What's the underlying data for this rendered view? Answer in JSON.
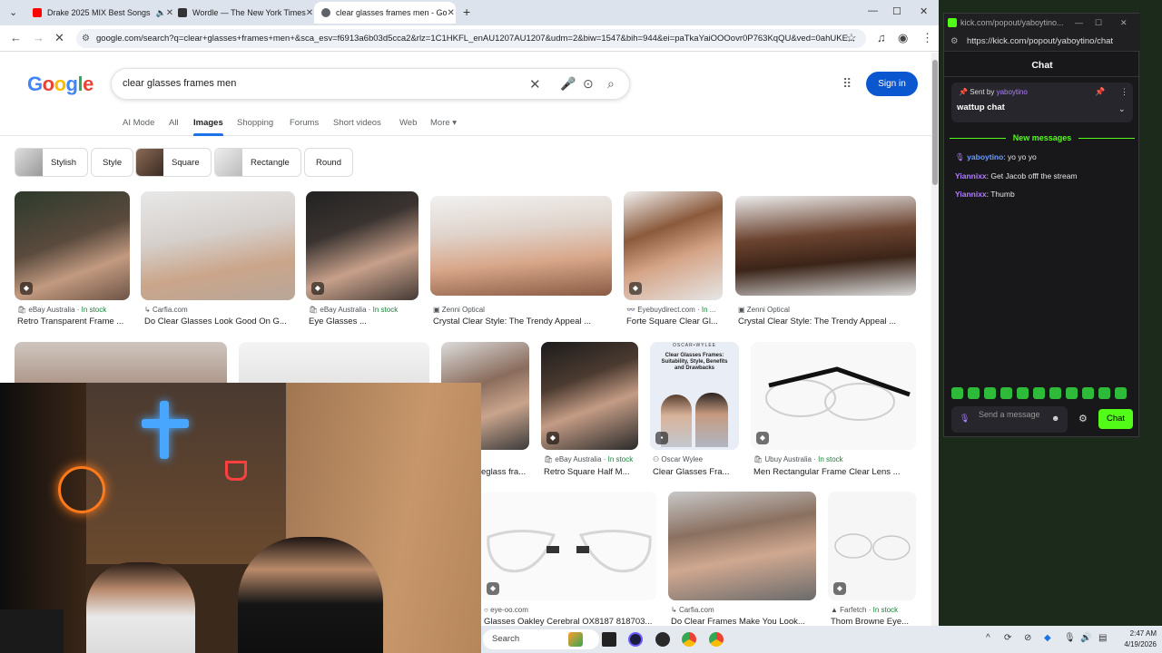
{
  "browser": {
    "tabs": [
      {
        "label": "Drake 2025 MIX Best Songs",
        "favicon_color": "#ff0000"
      },
      {
        "label": "Wordle — The New York Times",
        "favicon_color": "#333333"
      },
      {
        "label": "clear glasses frames men - Go",
        "favicon_color": "#5f6368"
      }
    ],
    "url": "google.com/search?q=clear+glasses+frames+men+&sca_esv=f6913a6b03d5cca2&rlz=1C1HKFL_enAU1207AU1207&udm=2&biw=1547&bih=944&ei=paTkaYaiOOOovr0P763KqQU&ved=0ahUKE..."
  },
  "google": {
    "logo": "Google",
    "query": "clear glasses frames men",
    "sign_in": "Sign in",
    "tabs": [
      "AI Mode",
      "All",
      "Images",
      "Shopping",
      "Forums",
      "Short videos",
      "Web",
      "More"
    ],
    "active_tab": "Images",
    "chips": [
      "Stylish",
      "Style",
      "Square",
      "Rectangle",
      "Round"
    ],
    "results": [
      {
        "source": "eBay Australia",
        "stock": "In stock",
        "title": "Retro Transparent Frame ..."
      },
      {
        "source": "Carfia.com",
        "stock": "",
        "title": "Do Clear Glasses Look Good On G..."
      },
      {
        "source": "eBay Australia",
        "stock": "In stock",
        "title": "Eye Glasses ..."
      },
      {
        "source": "Zenni Optical",
        "stock": "",
        "title": "Crystal Clear Style: The Trendy Appeal ..."
      },
      {
        "source": "Eyebuydirect.com",
        "stock": "In ...",
        "title": "Forte Square Clear Gl..."
      },
      {
        "source": "Zenni Optical",
        "stock": "",
        "title": "Crystal Clear Style: The Trendy Appeal ..."
      },
      {
        "source": "",
        "stock": "",
        "title": "eglass fra..."
      },
      {
        "source": "eBay Australia",
        "stock": "In stock",
        "title": "Retro Square Half M..."
      },
      {
        "source": "Oscar Wylee",
        "stock": "",
        "title": "Clear Glasses Fra..."
      },
      {
        "source": "Ubuy Australia",
        "stock": "In stock",
        "title": "Men Rectangular Frame Clear Lens ..."
      },
      {
        "source": "eye-oo.com",
        "stock": "",
        "title": "Glasses Oakley Cerebral OX8187 818703..."
      },
      {
        "source": "Carfia.com",
        "stock": "",
        "title": "Do Clear Frames Make You Look..."
      },
      {
        "source": "Farfetch",
        "stock": "In stock",
        "title": "Thom Browne Eye..."
      }
    ],
    "oscar_card": {
      "brand": "OSCAR•WYLEE",
      "text": "Clear Glasses Frames: Suitability, Style, Benefits and Drawbacks"
    }
  },
  "taskbar": {
    "search": "Search",
    "time": "2:47 AM",
    "date": "4/19/2026"
  },
  "kick": {
    "window_title": "kick.com/popout/yaboytino...",
    "url": "https://kick.com/popout/yaboytino/chat",
    "header": "Chat",
    "pinned_prefix": "Sent by",
    "pinned_user": "yaboytino",
    "pinned_message": "wattup chat",
    "new_messages": "New messages",
    "messages": [
      {
        "user": "yaboytino",
        "text": ": yo yo yo"
      },
      {
        "user": "Yiannixx",
        "text": ": Get Jacob offf the stream"
      },
      {
        "user": "Yiannixx",
        "text": ": Thumb"
      }
    ],
    "input_placeholder": "Send a message",
    "send_label": "Chat",
    "accent": "#53fc18"
  }
}
